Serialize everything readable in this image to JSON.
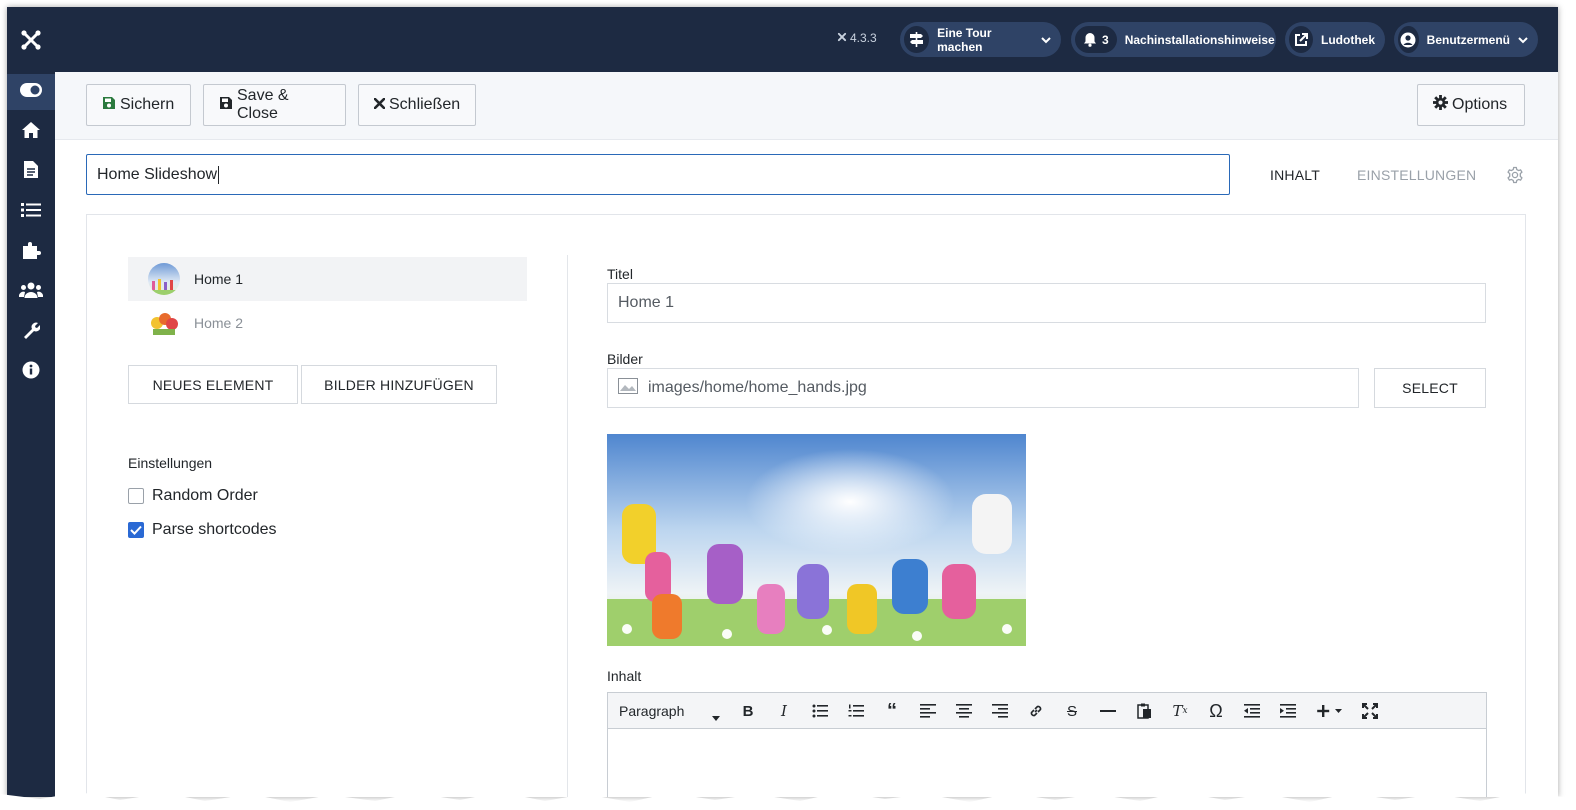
{
  "header": {
    "version": "4.3.3",
    "tour_label": "Eine Tour machen",
    "notifications_count": "3",
    "notifications_label": "Nachinstallationshinweise",
    "site_label": "Ludothek",
    "user_menu_label": "Benutzermenü"
  },
  "sidebar": {
    "items": [
      {
        "name": "toggle-menu",
        "icon": "toggle-icon"
      },
      {
        "name": "home",
        "icon": "home-icon"
      },
      {
        "name": "content",
        "icon": "file-icon"
      },
      {
        "name": "menus",
        "icon": "list-icon"
      },
      {
        "name": "extensions",
        "icon": "puzzle-icon"
      },
      {
        "name": "users",
        "icon": "users-icon"
      },
      {
        "name": "system",
        "icon": "wrench-icon"
      },
      {
        "name": "help",
        "icon": "info-icon"
      }
    ]
  },
  "toolbar": {
    "save_label": "Sichern",
    "save_close_label": "Save & Close",
    "close_label": "Schließen",
    "options_label": "Options"
  },
  "form": {
    "title_value": "Home Slideshow",
    "tab_content": "INHALT",
    "tab_settings": "EINSTELLUNGEN"
  },
  "slides": {
    "items": [
      {
        "label": "Home 1",
        "selected": true
      },
      {
        "label": "Home 2",
        "selected": false
      }
    ],
    "new_element_label": "NEUES ELEMENT",
    "add_images_label": "BILDER HINZUFÜGEN"
  },
  "settings": {
    "heading": "Einstellungen",
    "random_order_label": "Random Order",
    "random_order_checked": false,
    "parse_shortcodes_label": "Parse shortcodes",
    "parse_shortcodes_checked": true
  },
  "detail": {
    "title_label": "Titel",
    "title_value": "Home 1",
    "images_label": "Bilder",
    "image_path": "images/home/home_hands.jpg",
    "select_label": "SELECT",
    "content_label": "Inhalt",
    "editor_format": "Paragraph"
  },
  "colors": {
    "sidebar_bg": "#1d2a42",
    "pill_bg": "#2f4366",
    "accent": "#2a69d4",
    "save_icon": "#2b7a3e"
  }
}
